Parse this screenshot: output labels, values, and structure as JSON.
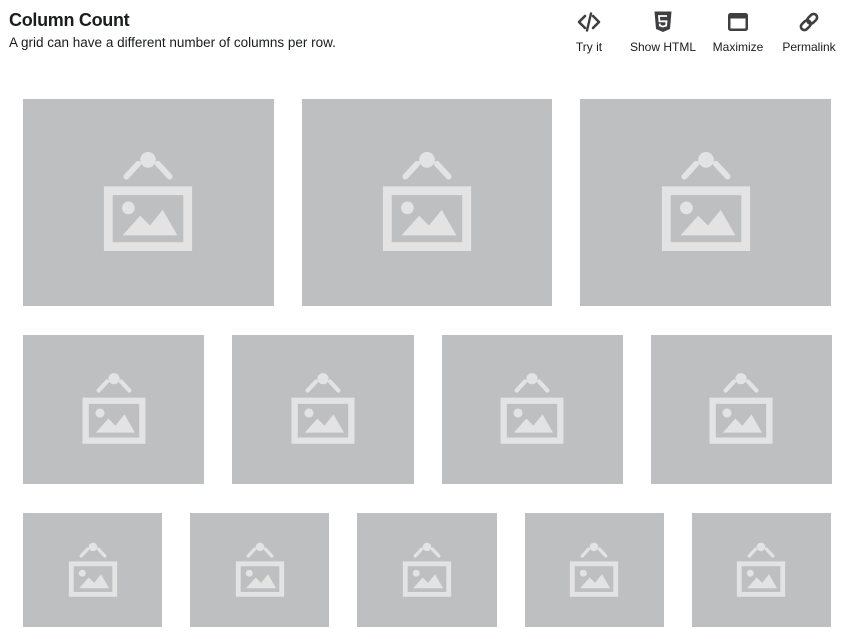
{
  "header": {
    "title": "Column Count",
    "description": "A grid can have a different number of columns per row."
  },
  "actions": [
    {
      "label": "Try it",
      "icon": "code-icon"
    },
    {
      "label": "Show HTML",
      "icon": "html5-icon"
    },
    {
      "label": "Maximize",
      "icon": "window-maximize-icon"
    },
    {
      "label": "Permalink",
      "icon": "link-icon"
    }
  ],
  "grid": {
    "rows": [
      {
        "columns": 3
      },
      {
        "columns": 4
      },
      {
        "columns": 5
      }
    ],
    "placeholder_icon": "image-placeholder-icon",
    "colors": {
      "tile": "#bebfc0",
      "icon": "#e3e3e4"
    }
  }
}
